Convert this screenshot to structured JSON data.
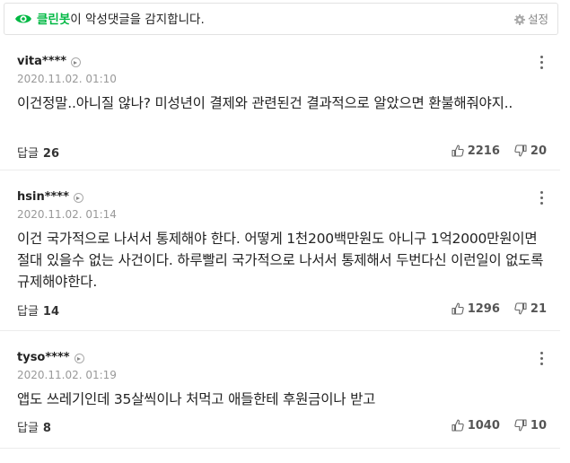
{
  "banner": {
    "brand": "클린봇",
    "message": "이 악성댓글을 감지합니다.",
    "settings_label": "설정",
    "brand_color": "#00b843"
  },
  "reply_label": "답글",
  "comments": [
    {
      "author": "vita****",
      "date": "2020.11.02. 01:10",
      "text": "이건정말..아니질 않나? 미성년이 결제와 관련된건 결과적으로 알았으면 환불해줘야지..",
      "replies": "26",
      "likes": "2216",
      "dislikes": "20"
    },
    {
      "author": "hsin****",
      "date": "2020.11.02. 01:14",
      "text": "이건 국가적으로 나서서 통제해야 한다. 어떻게 1천200백만원도 아니구 1억2000만원이면 절대 있을수 없는 사건이다. 하루빨리 국가적으로 나서서 통제해서 두번다신 이런일이 없도록 규제해야한다.",
      "replies": "14",
      "likes": "1296",
      "dislikes": "21"
    },
    {
      "author": "tyso****",
      "date": "2020.11.02. 01:19",
      "text": "앱도 쓰레기인데 35살씩이나 처먹고 애들한테 후원금이나 받고",
      "replies": "8",
      "likes": "1040",
      "dislikes": "10"
    }
  ]
}
